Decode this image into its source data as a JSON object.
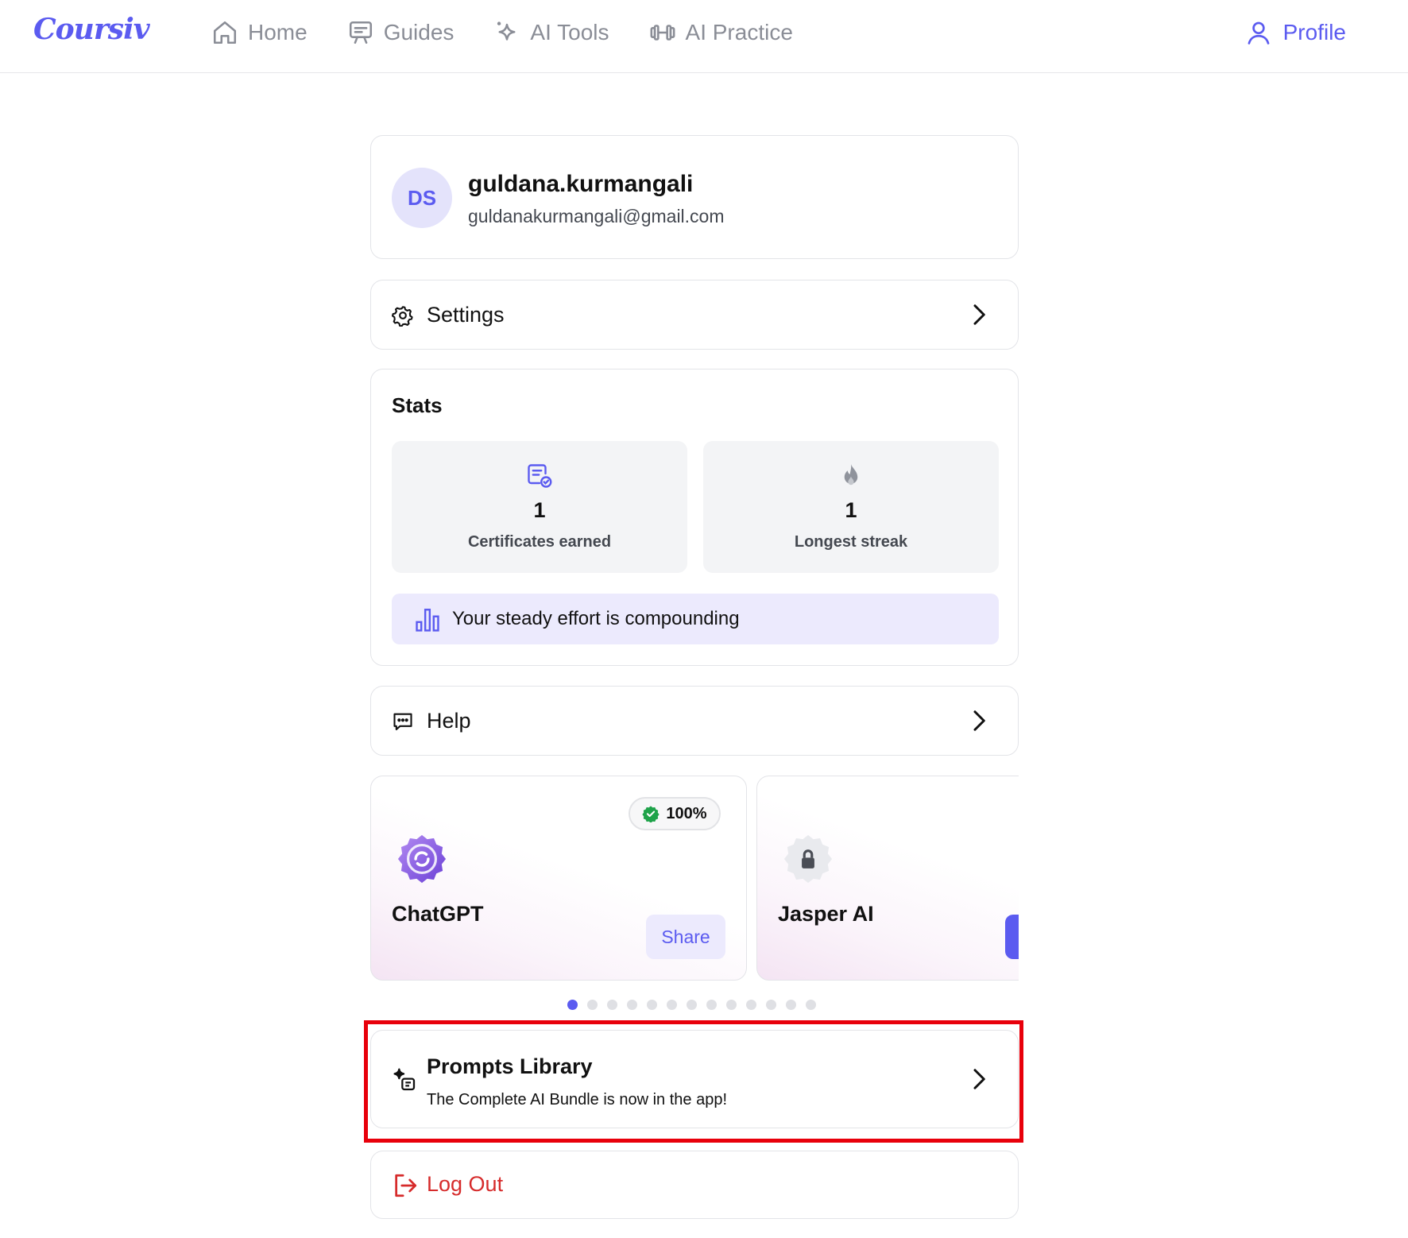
{
  "brand": {
    "logo_text": "Coursiv",
    "accent_color": "#5b5bf0"
  },
  "nav": {
    "items": [
      {
        "label": "Home",
        "icon": "home-icon"
      },
      {
        "label": "Guides",
        "icon": "guides-icon"
      },
      {
        "label": "AI Tools",
        "icon": "sparkle-icon"
      },
      {
        "label": "AI Practice",
        "icon": "dumbbell-icon"
      }
    ],
    "profile_label": "Profile"
  },
  "user": {
    "initials": "DS",
    "username": "guldana.kurmangali",
    "email": "guldanakurmangali@gmail.com"
  },
  "settings": {
    "label": "Settings",
    "icon": "gear-icon"
  },
  "stats": {
    "title": "Stats",
    "certificates": {
      "value": "1",
      "label": "Certificates earned",
      "icon": "certificate-icon"
    },
    "streak": {
      "value": "1",
      "label": "Longest streak",
      "icon": "flame-icon"
    },
    "effort_message": "Your steady effort is compounding"
  },
  "help": {
    "label": "Help",
    "icon": "chat-icon"
  },
  "certificates_carousel": {
    "cards": [
      {
        "name": "ChatGPT",
        "progress": "100%",
        "share_label": "Share",
        "locked": false
      },
      {
        "name": "Jasper AI",
        "locked": true
      }
    ],
    "dot_count": 13,
    "active_dot": 0
  },
  "prompts_library": {
    "title": "Prompts Library",
    "subtitle": "The Complete AI Bundle is now in the app!"
  },
  "logout": {
    "label": "Log Out",
    "color": "#d62b2b"
  }
}
